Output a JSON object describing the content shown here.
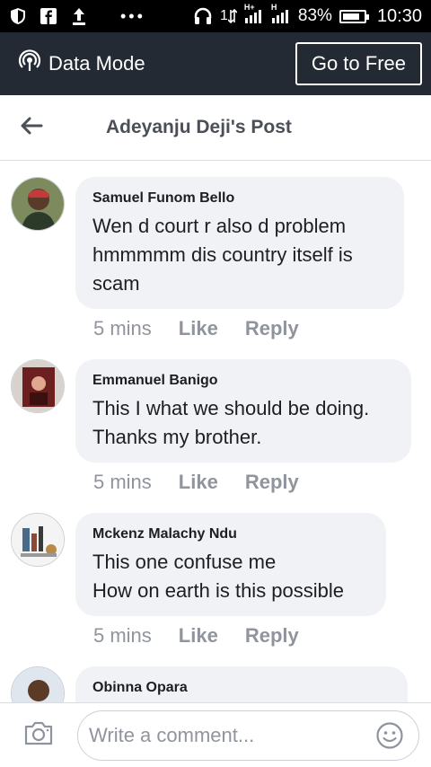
{
  "status_bar": {
    "signal_prefix": "1",
    "battery": "83%",
    "battery_level": 0.83,
    "time": "10:30",
    "network_1": "H+",
    "network_2": "H"
  },
  "data_bar": {
    "mode_label": "Data Mode",
    "go_free_label": "Go to Free"
  },
  "header": {
    "title": "Adeyanju Deji's Post"
  },
  "comments": [
    {
      "name": "Samuel Funom Bello",
      "text": "Wen d court r also d problem\nhmmmmm dis country itself is\nscam",
      "time": "5 mins",
      "like": "Like",
      "reply": "Reply"
    },
    {
      "name": "Emmanuel Banigo",
      "text": "This I what we should be doing.\nThanks my brother.",
      "time": "5 mins",
      "like": "Like",
      "reply": "Reply"
    },
    {
      "name": "Mckenz Malachy Ndu",
      "text": "This one confuse me\nHow on earth is this possible",
      "time": "5 mins",
      "like": "Like",
      "reply": "Reply"
    },
    {
      "name": "Obinna Opara",
      "text": "",
      "time": "",
      "like": "",
      "reply": ""
    }
  ],
  "composer": {
    "placeholder": "Write a comment..."
  },
  "colors": {
    "data_bar_bg": "#232a33",
    "bubble_bg": "#f0f2f5",
    "meta_text": "#90949c"
  },
  "icons": [
    "shield-icon",
    "facebook-icon",
    "upload-icon",
    "more-dots-icon",
    "headphones-icon",
    "data-arrows-icon",
    "signal-icon",
    "battery-icon",
    "broadcast-icon",
    "back-arrow-icon",
    "camera-icon",
    "emoji-icon"
  ]
}
